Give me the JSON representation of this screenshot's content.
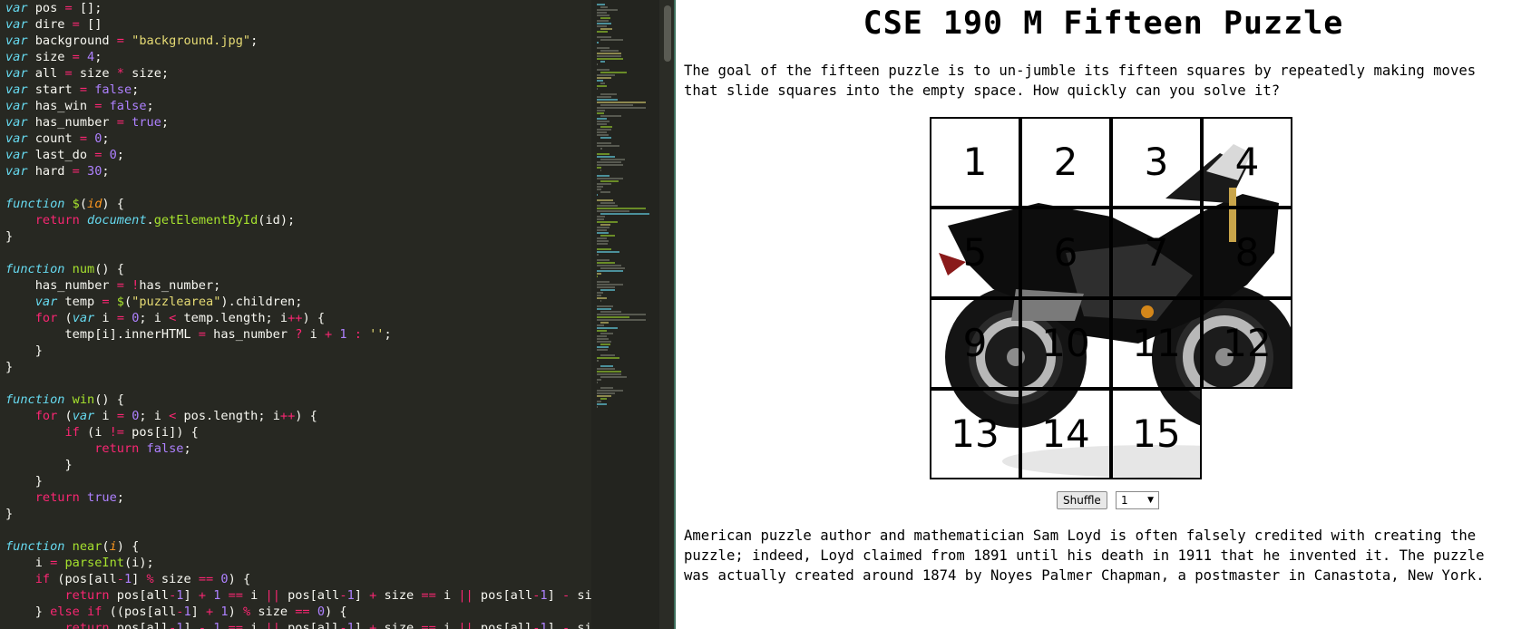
{
  "editor": {
    "code_lines": [
      [
        [
          "kw",
          "var"
        ],
        [
          "t",
          " pos "
        ],
        [
          "op",
          "="
        ],
        [
          "t",
          " [];"
        ]
      ],
      [
        [
          "kw",
          "var"
        ],
        [
          "t",
          " dire "
        ],
        [
          "op",
          "="
        ],
        [
          "t",
          " []"
        ]
      ],
      [
        [
          "kw",
          "var"
        ],
        [
          "t",
          " background "
        ],
        [
          "op",
          "="
        ],
        [
          "t",
          " "
        ],
        [
          "str",
          "\"background.jpg\""
        ],
        [
          "t",
          ";"
        ]
      ],
      [
        [
          "kw",
          "var"
        ],
        [
          "t",
          " size "
        ],
        [
          "op",
          "="
        ],
        [
          "t",
          " "
        ],
        [
          "num",
          "4"
        ],
        [
          "t",
          ";"
        ]
      ],
      [
        [
          "kw",
          "var"
        ],
        [
          "t",
          " all "
        ],
        [
          "op",
          "="
        ],
        [
          "t",
          " size "
        ],
        [
          "op",
          "*"
        ],
        [
          "t",
          " size;"
        ]
      ],
      [
        [
          "kw",
          "var"
        ],
        [
          "t",
          " start "
        ],
        [
          "op",
          "="
        ],
        [
          "t",
          " "
        ],
        [
          "num",
          "false"
        ],
        [
          "t",
          ";"
        ]
      ],
      [
        [
          "kw",
          "var"
        ],
        [
          "t",
          " has_win "
        ],
        [
          "op",
          "="
        ],
        [
          "t",
          " "
        ],
        [
          "num",
          "false"
        ],
        [
          "t",
          ";"
        ]
      ],
      [
        [
          "kw",
          "var"
        ],
        [
          "t",
          " has_number "
        ],
        [
          "op",
          "="
        ],
        [
          "t",
          " "
        ],
        [
          "num",
          "true"
        ],
        [
          "t",
          ";"
        ]
      ],
      [
        [
          "kw",
          "var"
        ],
        [
          "t",
          " count "
        ],
        [
          "op",
          "="
        ],
        [
          "t",
          " "
        ],
        [
          "num",
          "0"
        ],
        [
          "t",
          ";"
        ]
      ],
      [
        [
          "kw",
          "var"
        ],
        [
          "t",
          " last_do "
        ],
        [
          "op",
          "="
        ],
        [
          "t",
          " "
        ],
        [
          "num",
          "0"
        ],
        [
          "t",
          ";"
        ]
      ],
      [
        [
          "kw",
          "var"
        ],
        [
          "t",
          " hard "
        ],
        [
          "op",
          "="
        ],
        [
          "t",
          " "
        ],
        [
          "num",
          "30"
        ],
        [
          "t",
          ";"
        ]
      ],
      [],
      [
        [
          "kw",
          "function"
        ],
        [
          "t",
          " "
        ],
        [
          "fn",
          "$"
        ],
        [
          "t",
          "("
        ],
        [
          "arg",
          "id"
        ],
        [
          "t",
          ") {"
        ]
      ],
      [
        [
          "t",
          "    "
        ],
        [
          "ctl",
          "return"
        ],
        [
          "t",
          " "
        ],
        [
          "kw",
          "document"
        ],
        [
          "t",
          "."
        ],
        [
          "fn",
          "getElementById"
        ],
        [
          "t",
          "(id);"
        ]
      ],
      [
        [
          "t",
          "}"
        ]
      ],
      [],
      [
        [
          "kw",
          "function"
        ],
        [
          "t",
          " "
        ],
        [
          "fn",
          "num"
        ],
        [
          "t",
          "() {"
        ]
      ],
      [
        [
          "t",
          "    has_number "
        ],
        [
          "op",
          "="
        ],
        [
          "t",
          " "
        ],
        [
          "op",
          "!"
        ],
        [
          "t",
          "has_number;"
        ]
      ],
      [
        [
          "t",
          "    "
        ],
        [
          "kw",
          "var"
        ],
        [
          "t",
          " temp "
        ],
        [
          "op",
          "="
        ],
        [
          "t",
          " "
        ],
        [
          "fn",
          "$"
        ],
        [
          "t",
          "("
        ],
        [
          "str",
          "\"puzzlearea\""
        ],
        [
          "t",
          ").children;"
        ]
      ],
      [
        [
          "t",
          "    "
        ],
        [
          "ctl",
          "for"
        ],
        [
          "t",
          " ("
        ],
        [
          "kw",
          "var"
        ],
        [
          "t",
          " i "
        ],
        [
          "op",
          "="
        ],
        [
          "t",
          " "
        ],
        [
          "num",
          "0"
        ],
        [
          "t",
          "; i "
        ],
        [
          "op",
          "<"
        ],
        [
          "t",
          " temp.length; i"
        ],
        [
          "op",
          "++"
        ],
        [
          "t",
          ") {"
        ]
      ],
      [
        [
          "t",
          "        temp[i].innerHTML "
        ],
        [
          "op",
          "="
        ],
        [
          "t",
          " has_number "
        ],
        [
          "op",
          "?"
        ],
        [
          "t",
          " i "
        ],
        [
          "op",
          "+"
        ],
        [
          "t",
          " "
        ],
        [
          "num",
          "1"
        ],
        [
          "t",
          " "
        ],
        [
          "op",
          ":"
        ],
        [
          "t",
          " "
        ],
        [
          "str",
          "''"
        ],
        [
          "t",
          ";"
        ]
      ],
      [
        [
          "t",
          "    }"
        ]
      ],
      [
        [
          "t",
          "}"
        ]
      ],
      [],
      [
        [
          "kw",
          "function"
        ],
        [
          "t",
          " "
        ],
        [
          "fn",
          "win"
        ],
        [
          "t",
          "() {"
        ]
      ],
      [
        [
          "t",
          "    "
        ],
        [
          "ctl",
          "for"
        ],
        [
          "t",
          " ("
        ],
        [
          "kw",
          "var"
        ],
        [
          "t",
          " i "
        ],
        [
          "op",
          "="
        ],
        [
          "t",
          " "
        ],
        [
          "num",
          "0"
        ],
        [
          "t",
          "; i "
        ],
        [
          "op",
          "<"
        ],
        [
          "t",
          " pos.length; i"
        ],
        [
          "op",
          "++"
        ],
        [
          "t",
          ") {"
        ]
      ],
      [
        [
          "t",
          "        "
        ],
        [
          "ctl",
          "if"
        ],
        [
          "t",
          " (i "
        ],
        [
          "op",
          "!="
        ],
        [
          "t",
          " pos[i]) {"
        ]
      ],
      [
        [
          "t",
          "            "
        ],
        [
          "ctl",
          "return"
        ],
        [
          "t",
          " "
        ],
        [
          "num",
          "false"
        ],
        [
          "t",
          ";"
        ]
      ],
      [
        [
          "t",
          "        }"
        ]
      ],
      [
        [
          "t",
          "    }"
        ]
      ],
      [
        [
          "t",
          "    "
        ],
        [
          "ctl",
          "return"
        ],
        [
          "t",
          " "
        ],
        [
          "num",
          "true"
        ],
        [
          "t",
          ";"
        ]
      ],
      [
        [
          "t",
          "}"
        ]
      ],
      [],
      [
        [
          "kw",
          "function"
        ],
        [
          "t",
          " "
        ],
        [
          "fn",
          "near"
        ],
        [
          "t",
          "("
        ],
        [
          "arg",
          "i"
        ],
        [
          "t",
          ") {"
        ]
      ],
      [
        [
          "t",
          "    i "
        ],
        [
          "op",
          "="
        ],
        [
          "t",
          " "
        ],
        [
          "fn",
          "parseInt"
        ],
        [
          "t",
          "(i);"
        ]
      ],
      [
        [
          "t",
          "    "
        ],
        [
          "ctl",
          "if"
        ],
        [
          "t",
          " (pos[all"
        ],
        [
          "op",
          "-"
        ],
        [
          "num",
          "1"
        ],
        [
          "t",
          "] "
        ],
        [
          "op",
          "%"
        ],
        [
          "t",
          " size "
        ],
        [
          "op",
          "=="
        ],
        [
          "t",
          " "
        ],
        [
          "num",
          "0"
        ],
        [
          "t",
          ") {"
        ]
      ],
      [
        [
          "t",
          "        "
        ],
        [
          "ctl",
          "return"
        ],
        [
          "t",
          " pos[all"
        ],
        [
          "op",
          "-"
        ],
        [
          "num",
          "1"
        ],
        [
          "t",
          "] "
        ],
        [
          "op",
          "+"
        ],
        [
          "t",
          " "
        ],
        [
          "num",
          "1"
        ],
        [
          "t",
          " "
        ],
        [
          "op",
          "=="
        ],
        [
          "t",
          " i "
        ],
        [
          "op",
          "||"
        ],
        [
          "t",
          " pos[all"
        ],
        [
          "op",
          "-"
        ],
        [
          "num",
          "1"
        ],
        [
          "t",
          "] "
        ],
        [
          "op",
          "+"
        ],
        [
          "t",
          " size "
        ],
        [
          "op",
          "=="
        ],
        [
          "t",
          " i "
        ],
        [
          "op",
          "||"
        ],
        [
          "t",
          " pos[all"
        ],
        [
          "op",
          "-"
        ],
        [
          "num",
          "1"
        ],
        [
          "t",
          "] "
        ],
        [
          "op",
          "-"
        ],
        [
          "t",
          " size"
        ]
      ],
      [
        [
          "t",
          "    } "
        ],
        [
          "ctl",
          "else"
        ],
        [
          "t",
          " "
        ],
        [
          "ctl",
          "if"
        ],
        [
          "t",
          " ((pos[all"
        ],
        [
          "op",
          "-"
        ],
        [
          "num",
          "1"
        ],
        [
          "t",
          "] "
        ],
        [
          "op",
          "+"
        ],
        [
          "t",
          " "
        ],
        [
          "num",
          "1"
        ],
        [
          "t",
          ") "
        ],
        [
          "op",
          "%"
        ],
        [
          "t",
          " size "
        ],
        [
          "op",
          "=="
        ],
        [
          "t",
          " "
        ],
        [
          "num",
          "0"
        ],
        [
          "t",
          ") {"
        ]
      ],
      [
        [
          "t",
          "        "
        ],
        [
          "ctl",
          "return"
        ],
        [
          "t",
          " pos[all"
        ],
        [
          "op",
          "-"
        ],
        [
          "num",
          "1"
        ],
        [
          "t",
          "] "
        ],
        [
          "op",
          "-"
        ],
        [
          "t",
          " "
        ],
        [
          "num",
          "1"
        ],
        [
          "t",
          " "
        ],
        [
          "op",
          "=="
        ],
        [
          "t",
          " i "
        ],
        [
          "op",
          "||"
        ],
        [
          "t",
          " pos[all"
        ],
        [
          "op",
          "-"
        ],
        [
          "num",
          "1"
        ],
        [
          "t",
          "] "
        ],
        [
          "op",
          "+"
        ],
        [
          "t",
          " size "
        ],
        [
          "op",
          "=="
        ],
        [
          "t",
          " i "
        ],
        [
          "op",
          "||"
        ],
        [
          "t",
          " pos[all"
        ],
        [
          "op",
          "-"
        ],
        [
          "num",
          "1"
        ],
        [
          "t",
          "] "
        ],
        [
          "op",
          "-"
        ],
        [
          "t",
          " size"
        ]
      ]
    ],
    "colors": {
      "background": "#272822",
      "text": "#f8f8f2",
      "keyword": "#66d9ef",
      "operator": "#f92672",
      "string": "#e6db74",
      "number": "#ae81ff",
      "function": "#a6e22e",
      "argument": "#fd971f"
    }
  },
  "page": {
    "title": "CSE 190 M Fifteen Puzzle",
    "intro": "The goal of the fifteen puzzle is to un-jumble its fifteen squares by repeatedly making moves that slide squares into the empty space. How quickly can you solve it?",
    "tiles": [
      "1",
      "2",
      "3",
      "4",
      "5",
      "6",
      "7",
      "8",
      "9",
      "10",
      "11",
      "12",
      "13",
      "14",
      "15"
    ],
    "shuffle_label": "Shuffle",
    "size_select_value": "1",
    "outro": "American puzzle author and mathematician Sam Loyd is often falsely credited with creating the puzzle; indeed, Loyd claimed from 1891 until his death in 1911 that he invented it. The puzzle was actually created around 1874 by Noyes Palmer Chapman, a postmaster in Canastota, New York.",
    "background_image": "motorcycle-icon"
  }
}
